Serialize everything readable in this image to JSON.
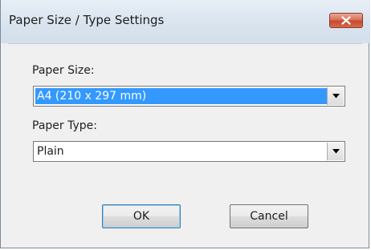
{
  "window": {
    "title": "Paper Size / Type Settings"
  },
  "paper_size": {
    "label": "Paper Size:",
    "value": "A4 (210 x 297 mm)"
  },
  "paper_type": {
    "label": "Paper Type:",
    "value": "Plain"
  },
  "buttons": {
    "ok": "OK",
    "cancel": "Cancel"
  },
  "icons": {
    "close": "close-icon",
    "dropdown": "chevron-down-icon"
  },
  "colors": {
    "selection": "#3399ff",
    "close_button": "#c9533a"
  }
}
